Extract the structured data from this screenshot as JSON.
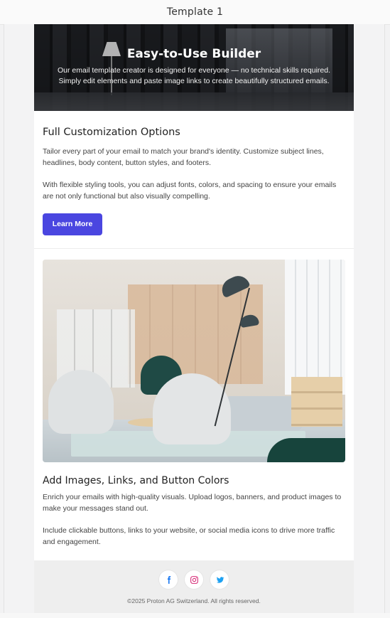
{
  "window": {
    "title": "Template 1"
  },
  "hero": {
    "heading": "Easy-to-Use Builder",
    "text": "Our email template creator is designed for everyone — no technical skills required. Simply edit elements and paste image links to create beautifully structured emails."
  },
  "section1": {
    "heading": "Full Customization Options",
    "paragraph1": "Tailor every part of your email to match your brand's identity. Customize subject lines, headlines, body content, button styles, and footers.",
    "paragraph2": "With flexible styling tools, you can adjust fonts, colors, and spacing to ensure your emails are not only functional but also visually compelling.",
    "button_label": "Learn More"
  },
  "section2": {
    "heading": "Add Images, Links, and Button Colors",
    "paragraph1": "Enrich your emails with high-quality visuals. Upload logos, banners, and product images to make your messages stand out.",
    "paragraph2": "Include clickable buttons, links to your website, or social media icons to drive more traffic and engagement."
  },
  "footer": {
    "social": [
      "facebook-icon",
      "instagram-icon",
      "twitter-icon"
    ],
    "copyright": "©2025 Proton AG Switzerland. All rights reserved."
  },
  "colors": {
    "button": "#4a46e0",
    "facebook": "#1877f2",
    "instagram": "#d62976",
    "twitter": "#1da1f2"
  }
}
